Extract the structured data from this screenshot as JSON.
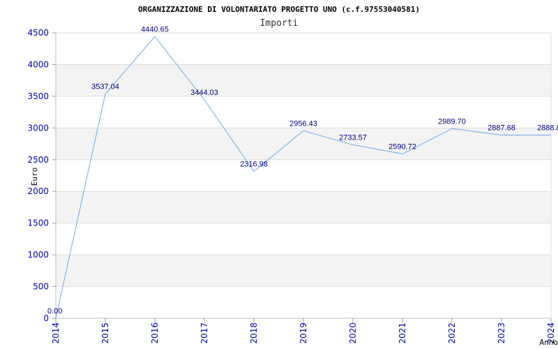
{
  "chart_data": {
    "type": "line",
    "title": "ORGANIZZAZIONE DI VOLONTARIATO PROGETTO UNO (c.f.97553040581)",
    "subtitle": "Importi",
    "xlabel": "Anno",
    "ylabel": "Euro",
    "categories": [
      "2014",
      "2015",
      "2016",
      "2017",
      "2018",
      "2019",
      "2020",
      "2021",
      "2022",
      "2023",
      "2024"
    ],
    "values": [
      0,
      3537.04,
      4440.65,
      3444.03,
      2316.98,
      2956.43,
      2733.57,
      2590.72,
      2989.7,
      2887.68,
      2888.8
    ],
    "data_labels": [
      "0.00",
      "3537.04",
      "4440.65",
      "3444.03",
      "2316.98",
      "2956.43",
      "2733.57",
      "2590.72",
      "2989.70",
      "2887.68",
      "2888.8"
    ],
    "ylim": [
      0,
      4500
    ],
    "yticks": [
      "0",
      "500",
      "1000",
      "1500",
      "2000",
      "2500",
      "3000",
      "3500",
      "4000",
      "4500"
    ],
    "grid": true,
    "legend": "none",
    "colors": {
      "line": "#6fa8e6",
      "tick_text": "#0000aa",
      "label_text": "#000080",
      "band": "#f3f3f3",
      "grid": "#dddddd"
    }
  }
}
